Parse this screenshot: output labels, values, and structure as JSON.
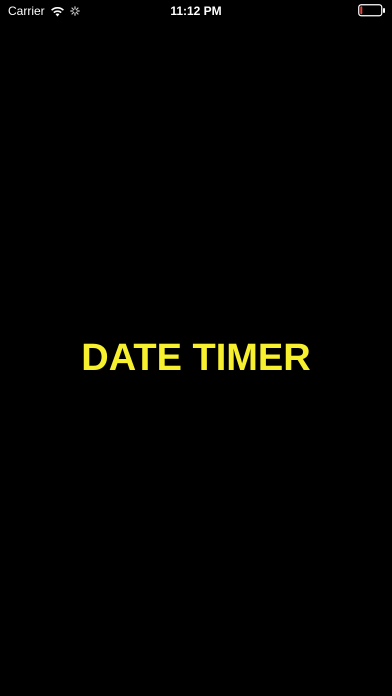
{
  "status_bar": {
    "carrier": "Carrier",
    "time": "11:12 PM",
    "wifi_icon": "wifi-icon",
    "activity_icon": "network-activity-icon",
    "battery_icon": "battery-icon",
    "battery_level": 0.1,
    "battery_color": "#e0463c"
  },
  "main": {
    "title": "DATE TIMER",
    "title_color": "#F7F02E",
    "background": "#000000"
  }
}
